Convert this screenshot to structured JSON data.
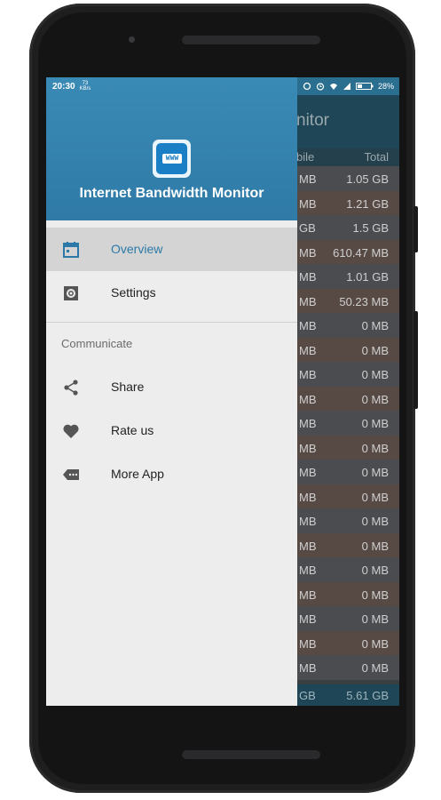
{
  "status": {
    "time": "20:30",
    "kb_top": "73",
    "kb_bottom": "KB/s",
    "battery": "28%"
  },
  "app": {
    "title_partial": "nitor",
    "col_mobile_partial": "bile",
    "col_total": "Total"
  },
  "table_rows": [
    {
      "a": "MB",
      "b": "1.05 GB"
    },
    {
      "a": "MB",
      "b": "1.21 GB"
    },
    {
      "a": "GB",
      "b": "1.5 GB"
    },
    {
      "a": "MB",
      "b": "610.47 MB"
    },
    {
      "a": "MB",
      "b": "1.01 GB"
    },
    {
      "a": "MB",
      "b": "50.23 MB"
    },
    {
      "a": "MB",
      "b": "0 MB"
    },
    {
      "a": "MB",
      "b": "0 MB"
    },
    {
      "a": "MB",
      "b": "0 MB"
    },
    {
      "a": "MB",
      "b": "0 MB"
    },
    {
      "a": "MB",
      "b": "0 MB"
    },
    {
      "a": "MB",
      "b": "0 MB"
    },
    {
      "a": "MB",
      "b": "0 MB"
    },
    {
      "a": "MB",
      "b": "0 MB"
    },
    {
      "a": "MB",
      "b": "0 MB"
    },
    {
      "a": "MB",
      "b": "0 MB"
    },
    {
      "a": "MB",
      "b": "0 MB"
    },
    {
      "a": "MB",
      "b": "0 MB"
    },
    {
      "a": "MB",
      "b": "0 MB"
    },
    {
      "a": "MB",
      "b": "0 MB"
    },
    {
      "a": "MB",
      "b": "0 MB"
    }
  ],
  "totals": {
    "a": "GB",
    "b": "5.61 GB"
  },
  "drawer": {
    "icon_text": "WWW",
    "title": "Internet Bandwidth Monitor",
    "items": [
      {
        "label": "Overview",
        "icon": "calendar-icon"
      },
      {
        "label": "Settings",
        "icon": "settings-icon"
      }
    ],
    "section_label": "Communicate",
    "communicate_items": [
      {
        "label": "Share",
        "icon": "share-icon"
      },
      {
        "label": "Rate us",
        "icon": "heart-icon"
      },
      {
        "label": "More App",
        "icon": "more-app-icon"
      }
    ]
  },
  "colors": {
    "accent": "#2c79a7",
    "header": "#3a8ab6",
    "drawer_bg": "#ededee"
  }
}
